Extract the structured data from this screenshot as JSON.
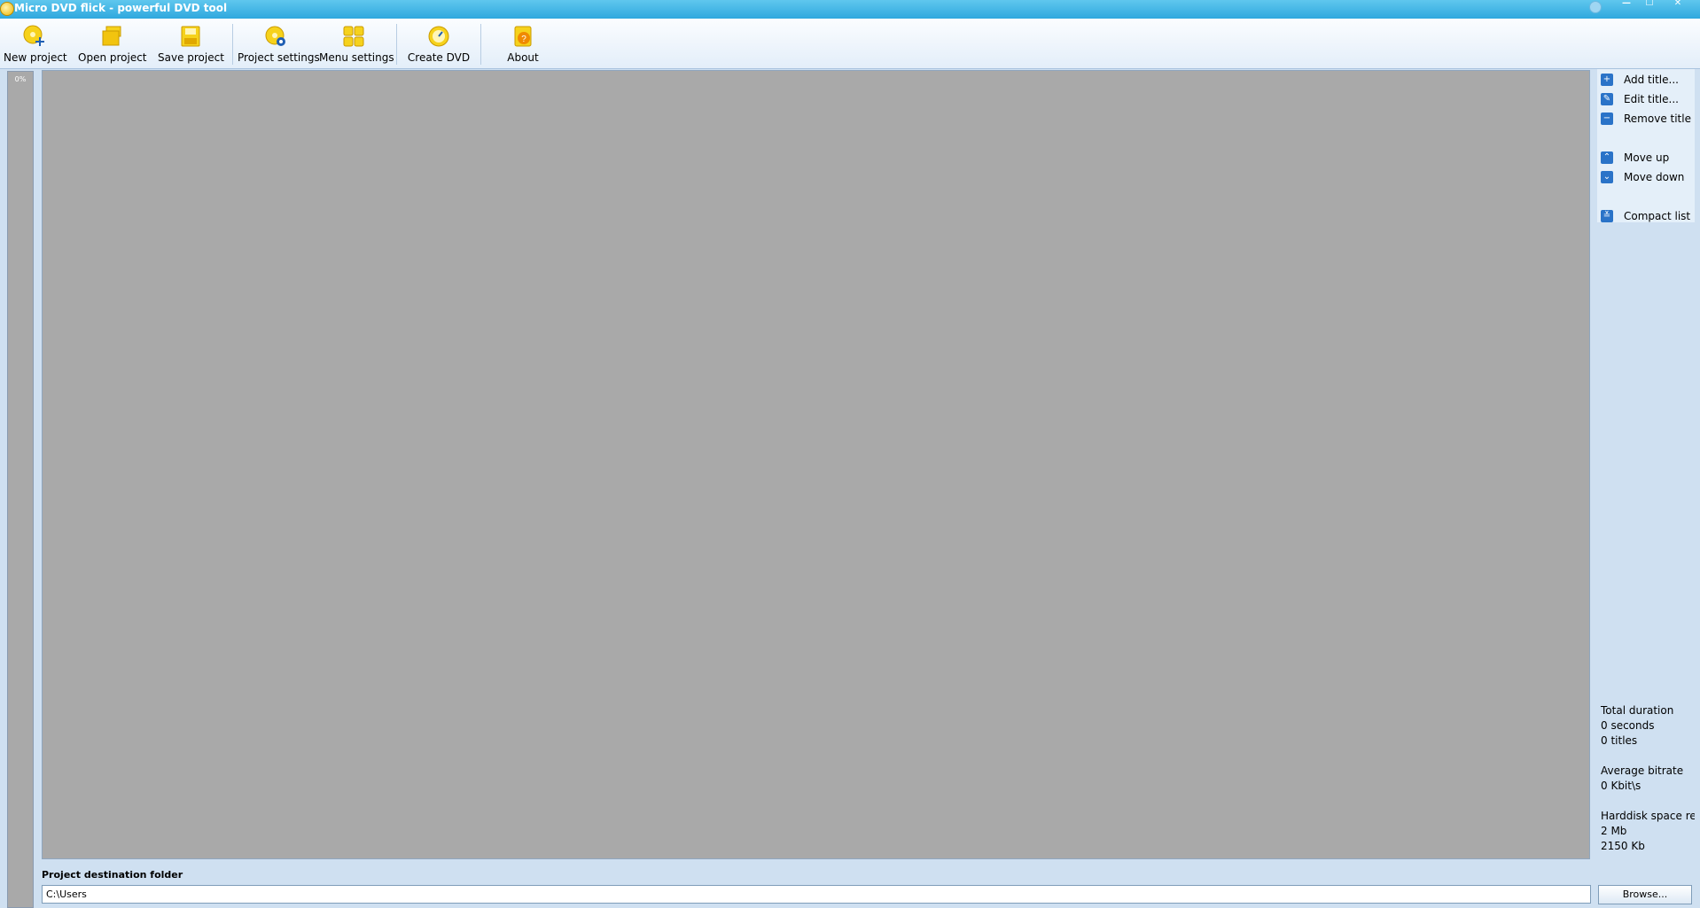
{
  "window": {
    "title": "Micro DVD flick - powerful DVD tool",
    "controls": {
      "minimize": "—",
      "maximize": "☐",
      "close": "✕"
    }
  },
  "toolbar": {
    "new_project": "New project",
    "open_project": "Open project",
    "save_project": "Save project",
    "project_settings": "Project settings",
    "menu_settings": "Menu settings",
    "create_dvd": "Create DVD",
    "about": "About"
  },
  "progress": {
    "label": "0%",
    "value": 0
  },
  "side_panel": {
    "add_title": "Add title...",
    "edit_title": "Edit title...",
    "remove_title": "Remove title",
    "move_up": "Move up",
    "move_down": "Move down",
    "compact_list": "Compact list"
  },
  "stats": {
    "total_duration_label": "Total duration",
    "duration_value": "0 seconds",
    "titles_value": "0 titles",
    "avg_bitrate_label": "Average bitrate",
    "bitrate_value": "0 Kbit\\s",
    "harddisk_label": "Harddisk space re",
    "harddisk_mb": "2 Mb",
    "harddisk_kb": "2150 Kb"
  },
  "destination": {
    "label": "Project destination folder",
    "value": "C:\\Users",
    "browse": "Browse..."
  },
  "colors": {
    "titlebar": "#2fa8de",
    "background": "#cfe0f1",
    "list_area": "#a9a9a9",
    "accent_icon": "#2a73c8",
    "toolbar_icon": "#f2c40f"
  }
}
